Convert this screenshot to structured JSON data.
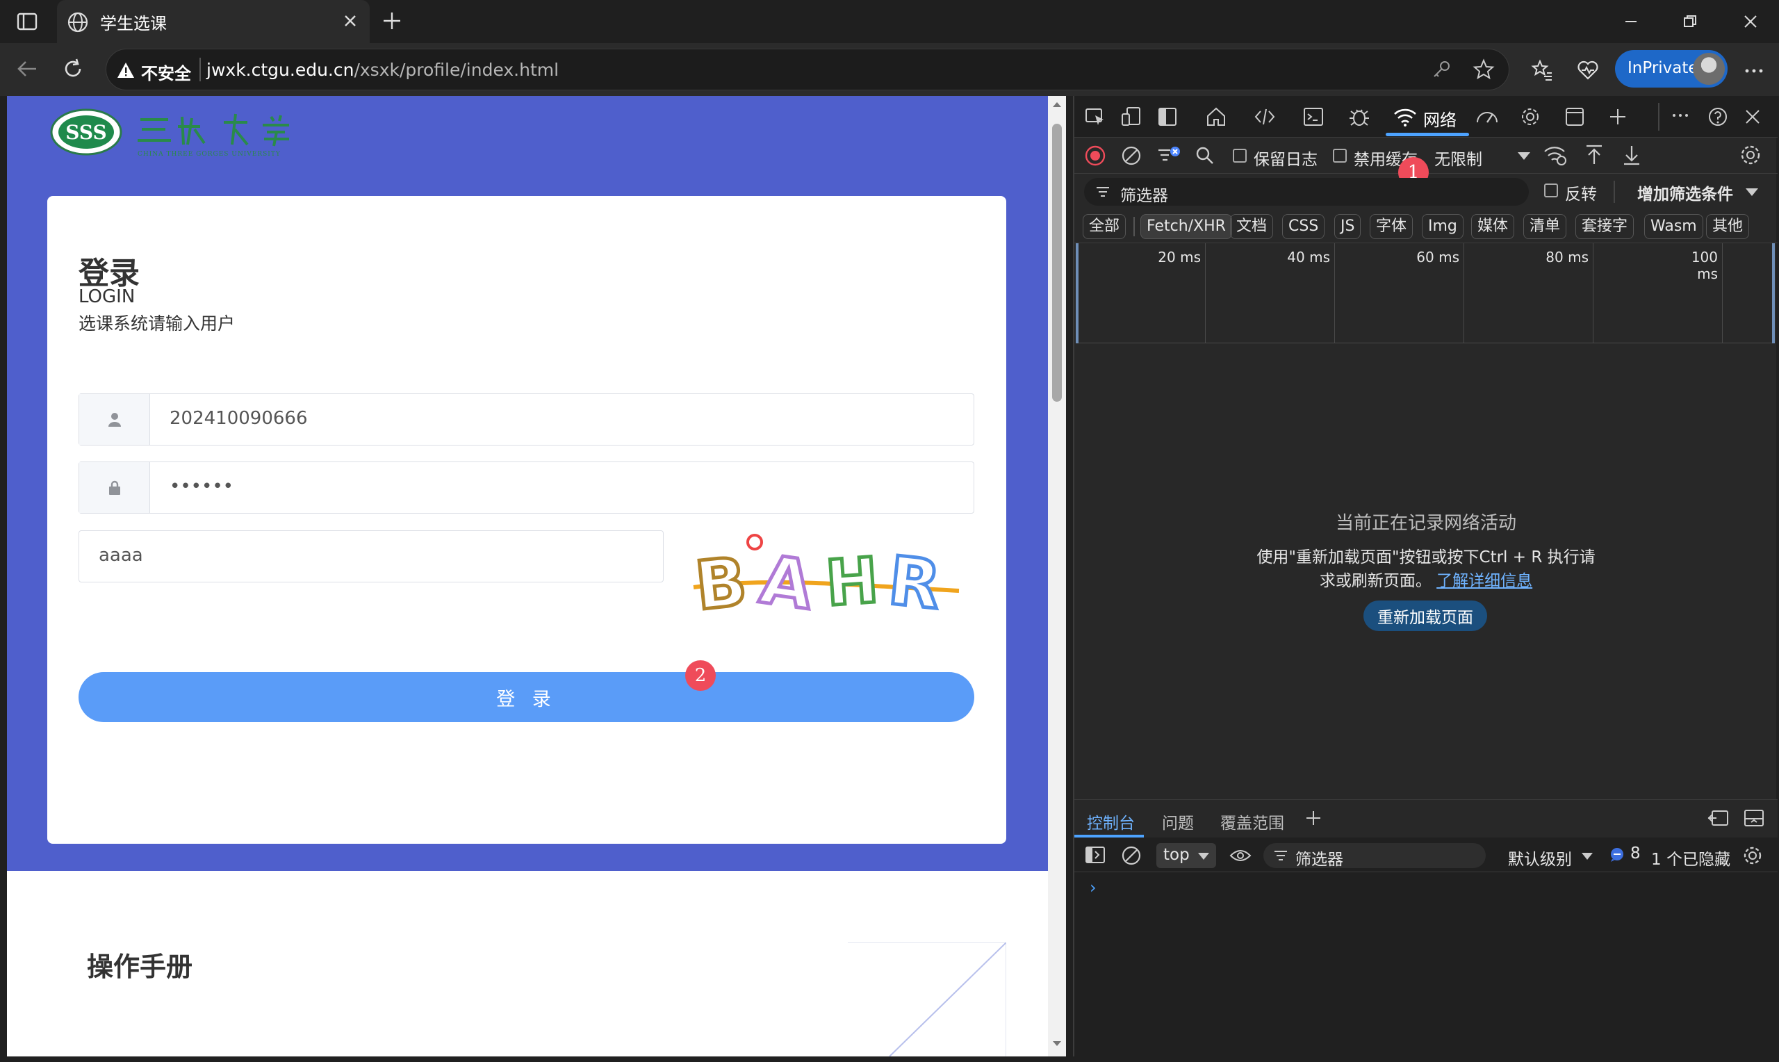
{
  "browser": {
    "tab_title": "学生选课",
    "address": {
      "security_label": "不安全",
      "host": "jwxk.ctgu.edu.cn",
      "path": "/xsxk/profile/index.html"
    },
    "inprivate_label": "InPrivate"
  },
  "page": {
    "login": {
      "title": "登录",
      "subtitle": "LOGIN",
      "description": "选课系统请输入用户",
      "username_value": "202410090666",
      "password_value": "••••••",
      "captcha_value": "aaaa",
      "captcha_text": "BAHR",
      "button_label": "登 录"
    },
    "manual_title": "操作手册",
    "brand_color": "#4f5fcc",
    "button_color": "#5a9cf8"
  },
  "markers": {
    "one": "1",
    "two": "2"
  },
  "devtools": {
    "network_tab_label": "网络",
    "preserve_log_label": "保留日志",
    "disable_cache_label": "禁用缓存",
    "throttle_label": "无限制",
    "filter_placeholder": "筛选器",
    "invert_label": "反转",
    "more_filters_label": "增加筛选条件",
    "type_filters": [
      "全部",
      "Fetch/XHR",
      "文档",
      "CSS",
      "JS",
      "字体",
      "Img",
      "媒体",
      "清单",
      "套接字",
      "Wasm",
      "其他"
    ],
    "timeline_ticks": [
      "20 ms",
      "40 ms",
      "60 ms",
      "80 ms",
      "100 ms"
    ],
    "empty_title": "当前正在记录网络活动",
    "empty_line1": "使用\"重新加载页面\"按钮或按下Ctrl + R 执行请",
    "empty_line2": "求或刷新页面。",
    "learn_more": "了解详细信息",
    "reload_button": "重新加载页面",
    "drawer_tabs": [
      "控制台",
      "问题",
      "覆盖范围"
    ],
    "console": {
      "context": "top",
      "filter_placeholder": "筛选器",
      "level": "默认级别",
      "message_count": "8",
      "hidden_count": "1 个已隐藏",
      "prompt": "›"
    }
  }
}
